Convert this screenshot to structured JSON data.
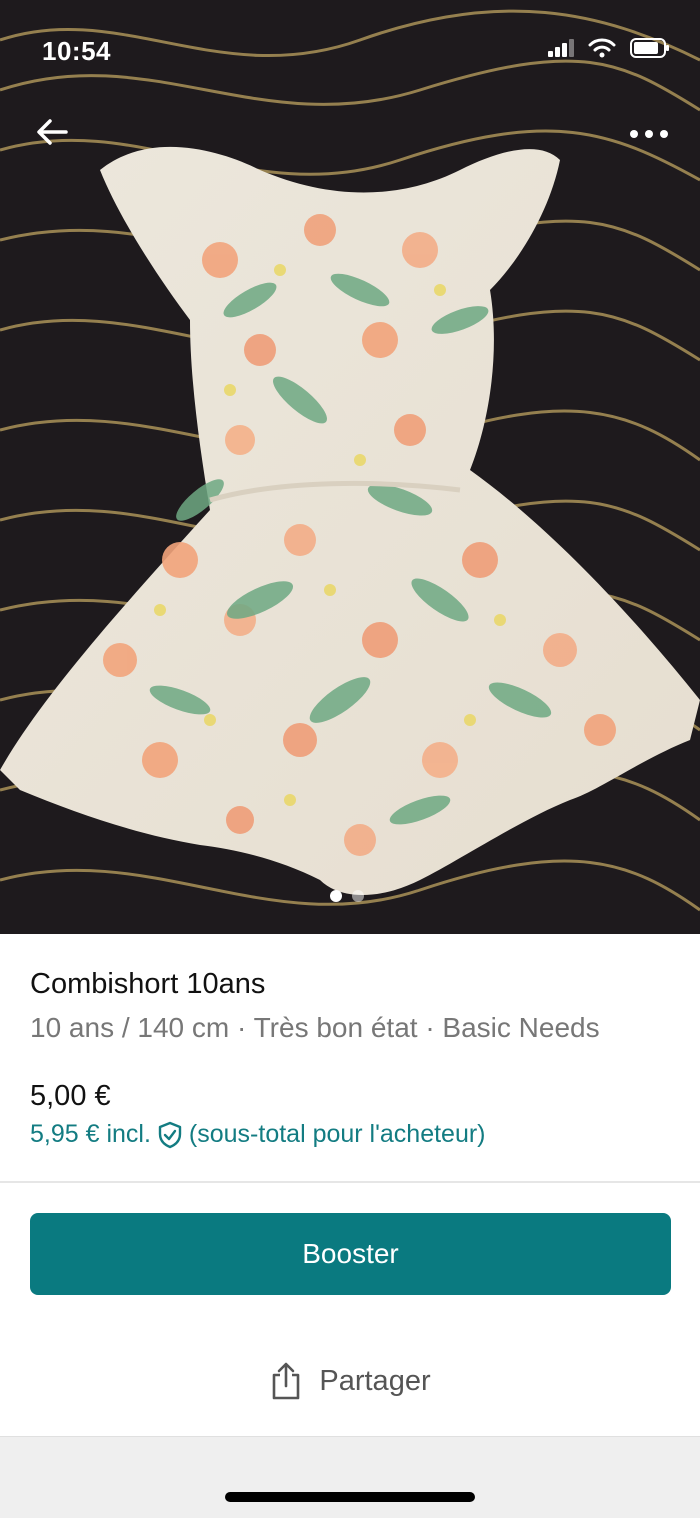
{
  "status_bar": {
    "time": "10:54"
  },
  "top_nav": {
    "back_icon": "arrow-left-icon",
    "more_icon": "more-horizontal-icon"
  },
  "photo": {
    "description_icon": "product-photo",
    "pages": 2,
    "active_page": 1
  },
  "item": {
    "title": "Combishort 10ans",
    "subtitle": "10 ans / 140 cm · Très bon état · Basic Needs",
    "price": "5,00 €",
    "buyer_price": "5,95 € incl.",
    "buyer_note": "(sous-total pour l'acheteur)"
  },
  "actions": {
    "booster_label": "Booster",
    "share_label": "Partager"
  },
  "colors": {
    "accent": "#0a7a80",
    "buyer_text": "#137c82"
  }
}
